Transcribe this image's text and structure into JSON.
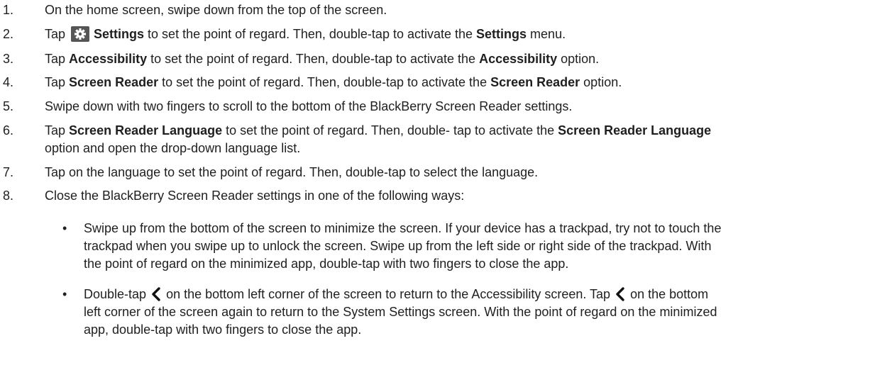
{
  "steps": [
    {
      "num": "1.",
      "parts": [
        "On the home screen, swipe down from the top of the screen."
      ]
    },
    {
      "num": "2.",
      "parts": [
        "Tap",
        "Settings",
        " to set the point of regard. Then, double-tap to activate the ",
        "Settings",
        " menu."
      ]
    },
    {
      "num": "3.",
      "parts": [
        "Tap ",
        "Accessibility",
        " to set the point of regard. Then, double-tap to activate the ",
        "Accessibility",
        " option."
      ]
    },
    {
      "num": "4.",
      "parts": [
        "Tap ",
        "Screen Reader",
        " to set the point of regard. Then, double-tap to activate the ",
        "Screen Reader",
        " option."
      ]
    },
    {
      "num": "5.",
      "parts": [
        "Swipe down with two fingers to scroll to the bottom of the BlackBerry Screen Reader settings."
      ]
    },
    {
      "num": "6.",
      "parts": [
        "Tap ",
        "Screen Reader Language",
        " to set the point of regard. Then, double- tap to activate the ",
        "Screen Reader Language",
        "option and open the drop-down language list."
      ]
    },
    {
      "num": "7.",
      "parts": [
        "Tap on the language to set the point of regard. Then, double-tap to select the language."
      ]
    },
    {
      "num": "8.",
      "parts": [
        "Close the BlackBerry Screen Reader settings in one of the following ways:"
      ]
    }
  ],
  "bullets": [
    {
      "symbol": "•",
      "lines": [
        "Swipe up from the bottom of the screen to minimize the screen. If your device has a trackpad, try not to touch the",
        "trackpad when you swipe up to unlock the screen. Swipe up from the left side or right side of the trackpad. With",
        "the point of regard on the minimized app, double-tap with two fingers to close the app."
      ]
    },
    {
      "symbol": "•",
      "parts": [
        "Double-tap",
        "on the bottom left corner of the screen to return to the Accessibility screen. Tap",
        "on the bottom"
      ],
      "lines": [
        "left corner of the screen again to return to the System Settings screen. With the point of regard on the minimized",
        "app, double-tap with two fingers to close the app."
      ]
    }
  ],
  "icons": {
    "settings": "gear-icon",
    "back": "chevron-left-icon"
  },
  "colors": {
    "text": "#1f1f1f",
    "icon_bg": "#555555"
  }
}
